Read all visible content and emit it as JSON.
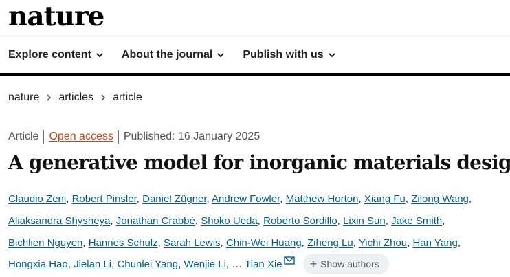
{
  "header": {
    "logo": "nature"
  },
  "nav": {
    "items": [
      {
        "label": "Explore content"
      },
      {
        "label": "About the journal"
      },
      {
        "label": "Publish with us"
      }
    ]
  },
  "breadcrumb": {
    "items": [
      "nature",
      "articles"
    ],
    "current": "article"
  },
  "meta": {
    "type": "Article",
    "access": "Open access",
    "published": "Published: 16 January 2025"
  },
  "article": {
    "title": "A generative model for inorganic materials design",
    "authors": [
      "Claudio Zeni",
      "Robert Pinsler",
      "Daniel Zügner",
      "Andrew Fowler",
      "Matthew Horton",
      "Xiang Fu",
      "Zilong Wang",
      "Aliaksandra Shysheya",
      "Jonathan Crabbé",
      "Shoko Ueda",
      "Roberto Sordillo",
      "Lixin Sun",
      "Jake Smith",
      "Bichlien Nguyen",
      "Hannes Schulz",
      "Sarah Lewis",
      "Chin-Wei Huang",
      "Ziheng Lu",
      "Yichi Zhou",
      "Han Yang",
      "Hongxia Hao",
      "Jielan Li",
      "Chunlei Yang",
      "Wenjie Li"
    ],
    "ellipsis": "…",
    "corresponding_author": "Tian Xie",
    "show_authors_label": "Show authors"
  },
  "colors": {
    "link": "#025e8d",
    "open_access": "#c6461b"
  },
  "icons": {
    "nav_chevron": "chevron-down-icon",
    "breadcrumb_sep": "chevron-right-icon",
    "email": "mail-icon",
    "expand": "plus-icon"
  }
}
